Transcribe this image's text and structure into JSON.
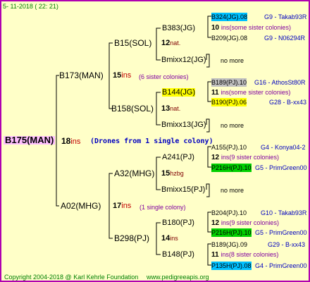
{
  "header": {
    "date": "5- 11-2018 ( 22: 21)"
  },
  "root": {
    "label": "B175(MAN)",
    "year": "18",
    "ins": "ins",
    "note": "(Drones from 1 single colony)"
  },
  "g2": {
    "b173": {
      "label": "B173(MAN)",
      "year": "15",
      "ins": "ins",
      "note": "(6 sister colonies)"
    },
    "a02": {
      "label": "A02(MHG)",
      "year": "17",
      "ins": "ins",
      "note": "(1 single colony)"
    }
  },
  "g3": {
    "b15": {
      "label": "B15(SOL)",
      "year": "12",
      "ins": "nat."
    },
    "b158": {
      "label": "B158(SOL)",
      "year": "13",
      "ins": "nat."
    },
    "a32": {
      "label": "A32(MHG)",
      "year": "15",
      "ins": "hzbg"
    },
    "b298": {
      "label": "B298(PJ)",
      "year": "14",
      "ins": "ins"
    }
  },
  "g4": {
    "b383": {
      "label": "B383(JG)",
      "year": "10",
      "note": "ins(some sister colonies)"
    },
    "bmixx12": {
      "label": "Bmixx12(JG)",
      "more": "no more"
    },
    "b144": {
      "label": "B144(JG)",
      "year": "11",
      "note": "ins(some sister colonies)"
    },
    "bmixx13": {
      "label": "Bmixx13(JG)",
      "more": "no more"
    },
    "a241": {
      "label": "A241(PJ)",
      "year": "12",
      "note": "ins(9 sister colonies)"
    },
    "bmixx15": {
      "label": "Bmixx15(PJ)",
      "more": "no more"
    },
    "b180": {
      "label": "B180(PJ)",
      "year": "12",
      "note": "ins(9 sister colonies)"
    },
    "b148": {
      "label": "B148(PJ)",
      "year": "11",
      "note": "ins(8 sister colonies)"
    }
  },
  "g5": {
    "b324": {
      "label": "B324(JG).08",
      "breeder": "G9 - Takab93R"
    },
    "b209": {
      "label": "B209(JG).08",
      "breeder": "G9 - N06294R"
    },
    "b189a": {
      "label": "B189(PJ).10",
      "breeder": "G16 - AthosSt80R"
    },
    "b190": {
      "label": "B190(PJ).06",
      "breeder": "G28 - B-xx43"
    },
    "a155": {
      "label": "A155(PJ).10",
      "breeder": "G4 - Konya04-2"
    },
    "p216a": {
      "label": "P216H(PJ).10",
      "breeder": "G5 - PrimGreen00"
    },
    "b204": {
      "label": "B204(PJ).10",
      "breeder": "G10 - Takab93R"
    },
    "p216b": {
      "label": "P216H(PJ).10",
      "breeder": "G5 - PrimGreen00"
    },
    "b189b": {
      "label": "B189(JG).09",
      "breeder": "G29 - B-xx43"
    },
    "p135": {
      "label": "P135H(PJ).08",
      "breeder": "G4 - PrimGreen00"
    }
  },
  "footer": {
    "copyright": "Copyright 2004-2018 @ Karl Kehrle Foundation",
    "site": "www.pedigreeapis.org"
  }
}
